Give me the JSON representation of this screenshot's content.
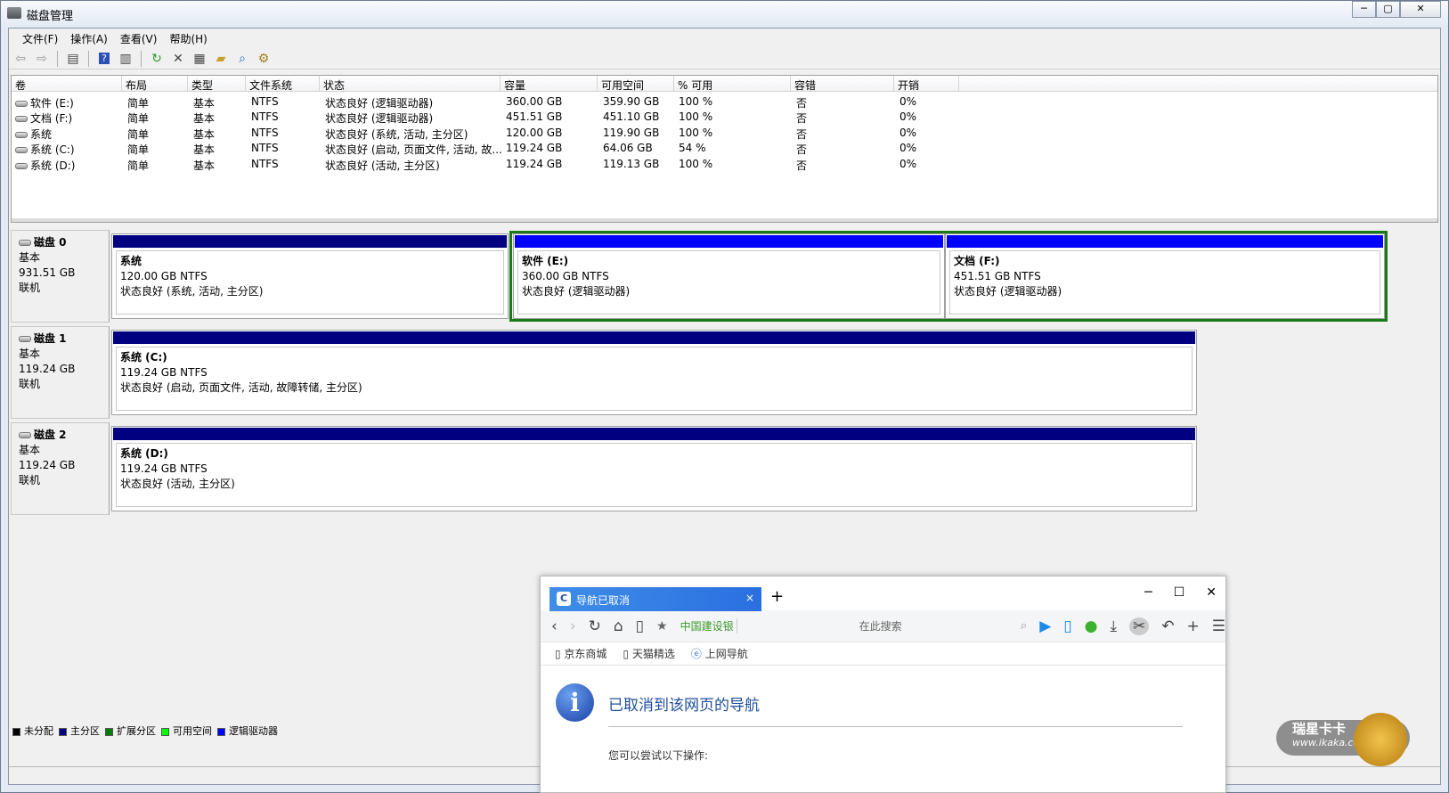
{
  "window": {
    "title": "磁盘管理",
    "buttons": [
      "─",
      "▢",
      "✕"
    ]
  },
  "menu": [
    "文件(F)",
    "操作(A)",
    "查看(V)",
    "帮助(H)"
  ],
  "toolbar": [
    "back-icon",
    "forward-icon",
    "console-tree-icon",
    "help-icon",
    "action-pane-icon",
    "refresh-icon",
    "delete-icon",
    "properties-icon",
    "open-icon",
    "explore-icon",
    "settings-icon"
  ],
  "volume_table": {
    "columns": [
      "卷",
      "布局",
      "类型",
      "文件系统",
      "状态",
      "容量",
      "可用空间",
      "% 可用",
      "容错",
      "开销"
    ],
    "rows": [
      [
        "软件 (E:)",
        "简单",
        "基本",
        "NTFS",
        "状态良好 (逻辑驱动器)",
        "360.00 GB",
        "359.90 GB",
        "100 %",
        "否",
        "0%"
      ],
      [
        "文档 (F:)",
        "简单",
        "基本",
        "NTFS",
        "状态良好 (逻辑驱动器)",
        "451.51 GB",
        "451.10 GB",
        "100 %",
        "否",
        "0%"
      ],
      [
        "系统",
        "简单",
        "基本",
        "NTFS",
        "状态良好 (系统, 活动, 主分区)",
        "120.00 GB",
        "119.90 GB",
        "100 %",
        "否",
        "0%"
      ],
      [
        "系统 (C:)",
        "简单",
        "基本",
        "NTFS",
        "状态良好 (启动, 页面文件, 活动, 故...",
        "119.24 GB",
        "64.06 GB",
        "54 %",
        "否",
        "0%"
      ],
      [
        "系统 (D:)",
        "简单",
        "基本",
        "NTFS",
        "状态良好 (活动, 主分区)",
        "119.24 GB",
        "119.13 GB",
        "100 %",
        "否",
        "0%"
      ]
    ]
  },
  "disks": [
    {
      "name": "磁盘 0",
      "type": "基本",
      "size": "931.51 GB",
      "state": "联机",
      "partitions": [
        {
          "name": "系统",
          "info": "120.00 GB NTFS",
          "status": "状态良好 (系统, 活动, 主分区)"
        },
        {
          "name": "软件  (E:)",
          "info": "360.00 GB NTFS",
          "status": "状态良好 (逻辑驱动器)"
        },
        {
          "name": "文档  (F:)",
          "info": "451.51 GB NTFS",
          "status": "状态良好 (逻辑驱动器)"
        }
      ]
    },
    {
      "name": "磁盘 1",
      "type": "基本",
      "size": "119.24 GB",
      "state": "联机",
      "partitions": [
        {
          "name": "系统  (C:)",
          "info": "119.24 GB NTFS",
          "status": "状态良好 (启动, 页面文件, 活动, 故障转储, 主分区)"
        }
      ]
    },
    {
      "name": "磁盘 2",
      "type": "基本",
      "size": "119.24 GB",
      "state": "联机",
      "partitions": [
        {
          "name": "系统  (D:)",
          "info": "119.24 GB NTFS",
          "status": "状态良好 (活动, 主分区)"
        }
      ]
    }
  ],
  "legend": [
    {
      "label": "未分配",
      "color": "#000000"
    },
    {
      "label": "主分区",
      "color": "#000080"
    },
    {
      "label": "扩展分区",
      "color": "#008000"
    },
    {
      "label": "可用空间",
      "color": "#00ff00"
    },
    {
      "label": "逻辑驱动器",
      "color": "#0000ff"
    }
  ],
  "browser": {
    "tab_title": "导航已取消",
    "tab_close": "×",
    "new_tab": "+",
    "win_buttons": [
      "─",
      "☐",
      "✕"
    ],
    "address_site": "中国建设银",
    "search_placeholder": "在此搜索",
    "bookmarks": [
      "京东商城",
      "天猫精选",
      "上网导航"
    ],
    "message": "已取消到该网页的导航",
    "suggestion": "您可以尝试以下操作:"
  },
  "watermark": {
    "text": "瑞星卡卡",
    "url": "www.ikaka.com"
  }
}
